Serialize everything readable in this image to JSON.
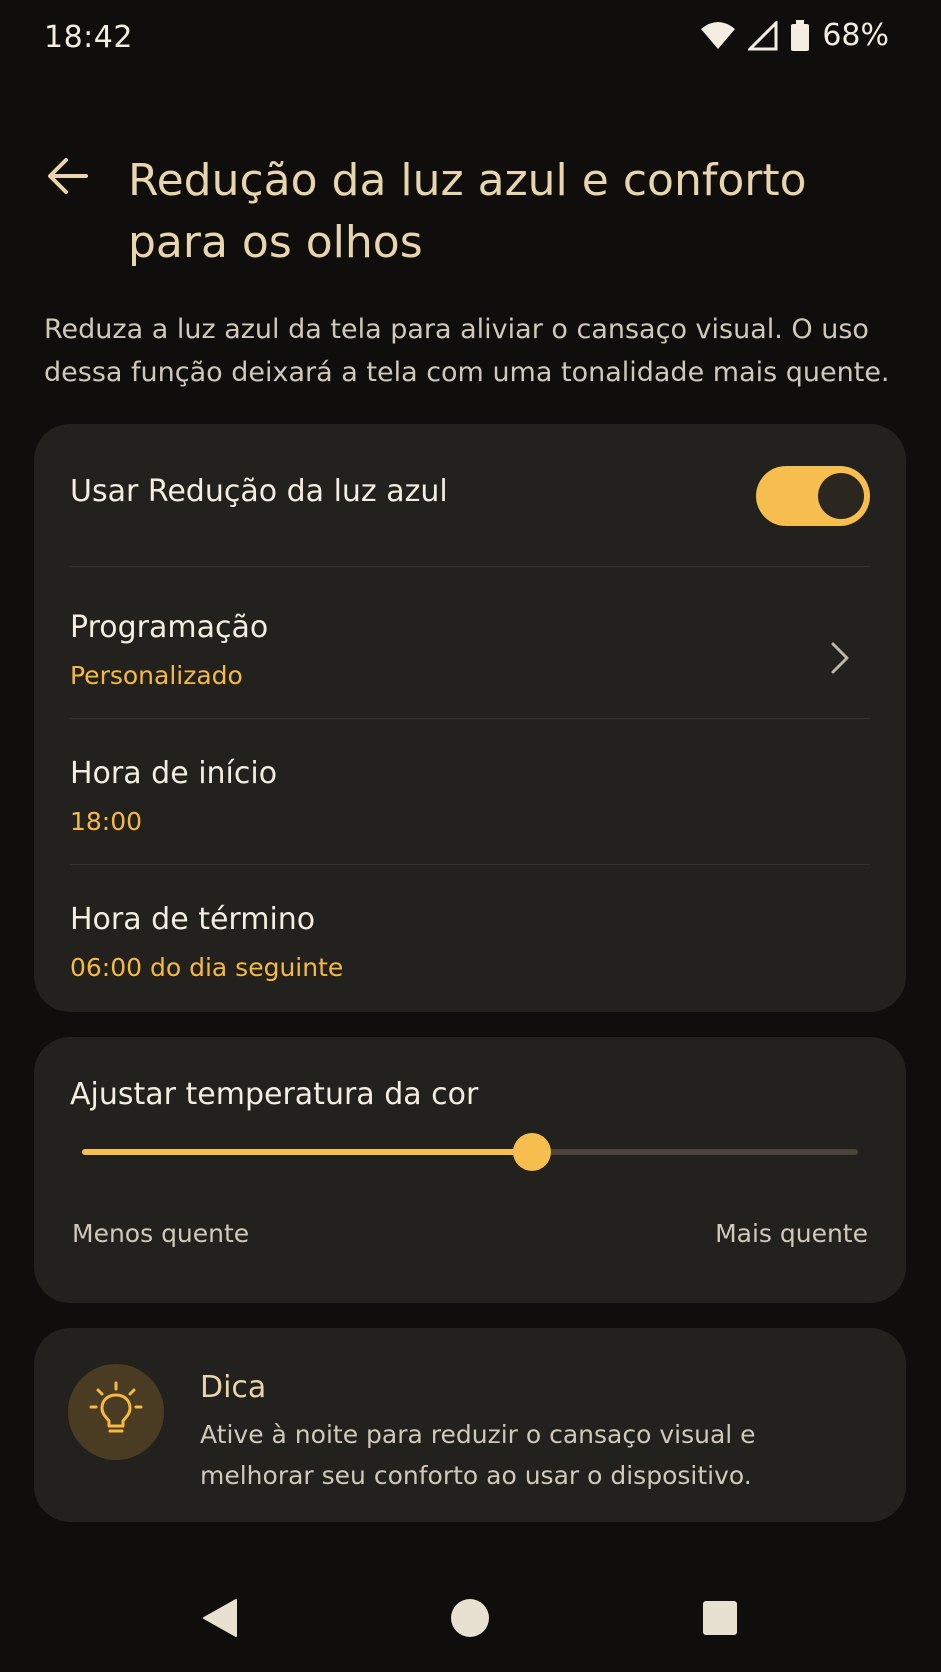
{
  "status_bar": {
    "time": "18:42",
    "battery_percent": "68%",
    "icons": [
      "wifi-icon",
      "signal-icon",
      "battery-icon"
    ]
  },
  "header": {
    "title": "Redução da luz azul e conforto para os olhos",
    "back_icon": "arrow-left-icon"
  },
  "description": "Reduza a luz azul da tela para aliviar o cansaço visual. O uso dessa função deixará a tela com uma tonalidade mais quente.",
  "settings": {
    "use_toggle": {
      "label": "Usar Redução da luz azul",
      "enabled": true
    },
    "schedule": {
      "title": "Programação",
      "value": "Personalizado",
      "icon": "chevron-right-icon"
    },
    "start_time": {
      "title": "Hora de início",
      "value": "18:00"
    },
    "end_time": {
      "title": "Hora de término",
      "value": "06:00 do dia seguinte"
    }
  },
  "temperature": {
    "title": "Ajustar temperatura da cor",
    "value_fraction": 0.58,
    "min_label": "Menos quente",
    "max_label": "Mais quente"
  },
  "tip": {
    "icon": "lightbulb-icon",
    "title": "Dica",
    "body": "Ative à noite para reduzir o cansaço visual e melhorar seu conforto ao usar o dispositivo."
  },
  "nav_bar": {
    "buttons": [
      "back-triangle-icon",
      "home-circle-icon",
      "recents-square-icon"
    ]
  },
  "colors": {
    "background": "#0f0e0c",
    "card": "#23211d",
    "accent": "#f6bd4f",
    "title": "#e8d5ad",
    "secondary_text": "#cfc8bb"
  }
}
